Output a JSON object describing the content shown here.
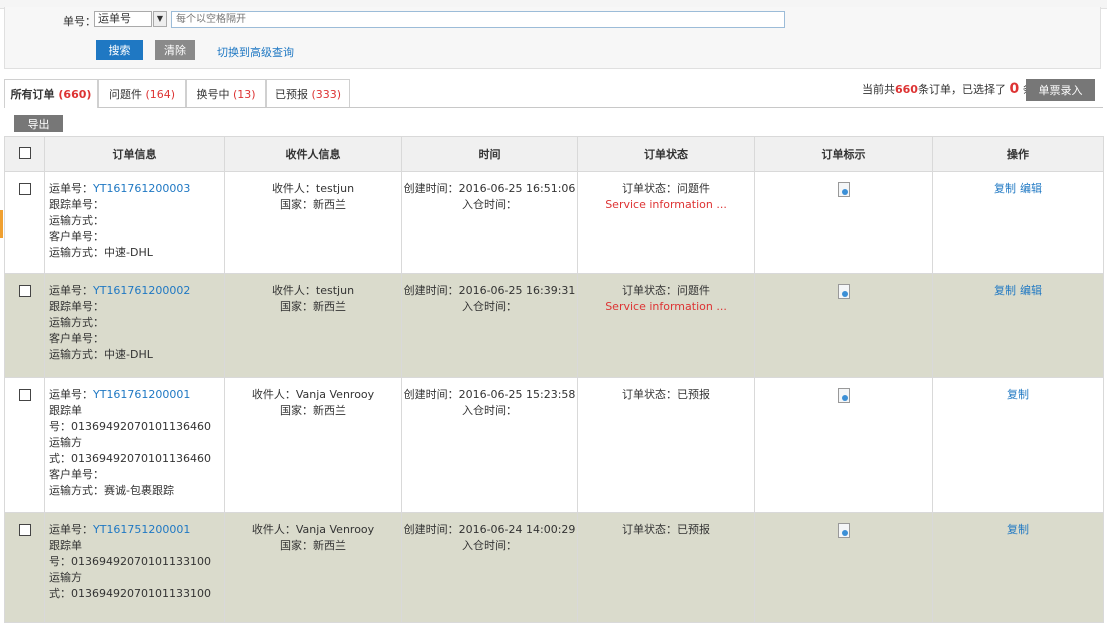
{
  "search": {
    "label": "单号",
    "colon": "：",
    "select_value": "运单号",
    "placeholder": "每个以空格隔开",
    "search_button": "搜索",
    "clear_button": "清除",
    "advanced_link": "切换到高级查询"
  },
  "tabs": [
    {
      "label": "所有订单",
      "count": "(660)"
    },
    {
      "label": "问题件",
      "count": "(164)"
    },
    {
      "label": "换号中",
      "count": "(13)"
    },
    {
      "label": "已预报",
      "count": "(333)"
    }
  ],
  "summary": {
    "prefix": "当前共",
    "total": "660",
    "middle": "条订单，已选择了",
    "selected": "0",
    "suffix": "条"
  },
  "single_entry_button": "单票录入",
  "export_button": "导出",
  "table": {
    "headers": [
      "订单信息",
      "收件人信息",
      "时间",
      "订单状态",
      "订单标示",
      "操作"
    ],
    "rows": [
      {
        "waybill_label": "运单号：",
        "waybill_no": "YT161761200003",
        "info_lines": [
          "跟踪单号：",
          "运输方式：",
          "客户单号：",
          "运输方式：中速-DHL"
        ],
        "recipient": "收件人：testjun",
        "country": "国家：新西兰",
        "created": "创建时间：2016-06-25 16:51:06",
        "warehoused": "入仓时间：",
        "status": "订单状态：问题件",
        "status_note": "Service information ...",
        "actions": [
          "复制",
          "编辑"
        ]
      },
      {
        "waybill_label": "运单号：",
        "waybill_no": "YT161761200002",
        "info_lines": [
          "跟踪单号：",
          "运输方式：",
          "客户单号：",
          "运输方式：中速-DHL"
        ],
        "recipient": "收件人：testjun",
        "country": "国家：新西兰",
        "created": "创建时间：2016-06-25 16:39:31",
        "warehoused": "入仓时间：",
        "status": "订单状态：问题件",
        "status_note": "Service information ...",
        "actions": [
          "复制",
          "编辑"
        ]
      },
      {
        "waybill_label": "运单号：",
        "waybill_no": "YT161761200001",
        "info_lines": [
          "跟踪单",
          "号：01369492070101136460",
          "运输方",
          "式：01369492070101136460",
          "客户单号：",
          "运输方式：赛诚-包裹跟踪"
        ],
        "recipient": "收件人：Vanja Venrooy",
        "country": "国家：新西兰",
        "created": "创建时间：2016-06-25 15:23:58",
        "warehoused": "入仓时间：",
        "status": "订单状态：已预报",
        "status_note": "",
        "actions": [
          "复制"
        ]
      },
      {
        "waybill_label": "运单号：",
        "waybill_no": "YT161751200001",
        "info_lines": [
          "跟踪单",
          "号：01369492070101133100",
          "运输方",
          "式：01369492070101133100"
        ],
        "recipient": "收件人：Vanja Venrooy",
        "country": "国家：新西兰",
        "created": "创建时间：2016-06-24 14:00:29",
        "warehoused": "入仓时间：",
        "status": "订单状态：已预报",
        "status_note": "",
        "actions": [
          "复制"
        ]
      }
    ]
  }
}
